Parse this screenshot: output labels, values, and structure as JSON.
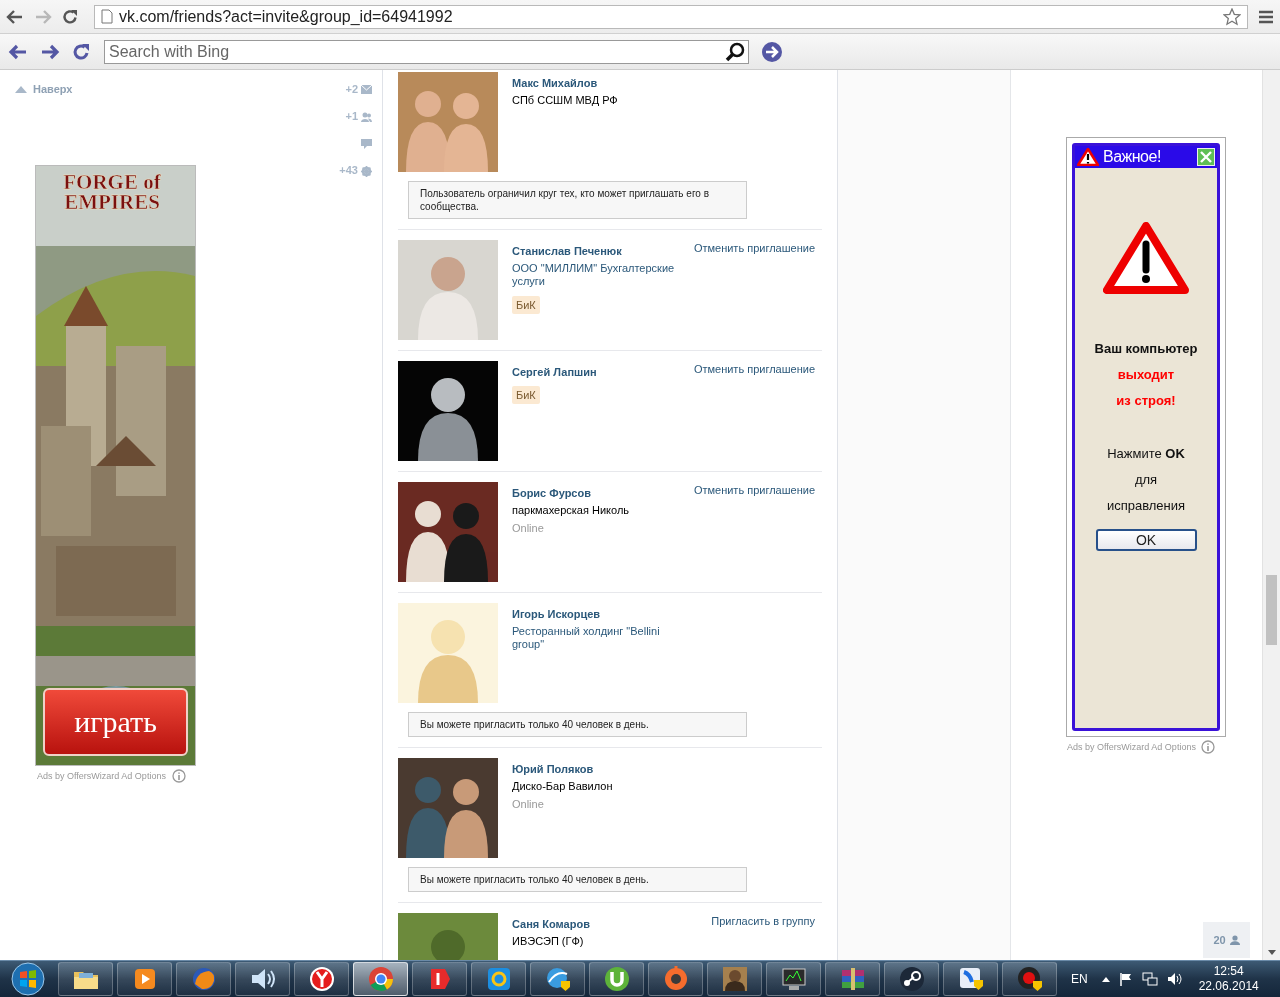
{
  "browser": {
    "url": "vk.com/friends?act=invite&group_id=64941992",
    "forward_disabled": true
  },
  "bing_bar": {
    "search": {
      "placeholder": "Search with Bing"
    }
  },
  "left_menu": {
    "top_link": "Наверх",
    "counters": [
      {
        "kind": "count",
        "count": "+2"
      },
      {
        "kind": "count",
        "count": "+1"
      },
      {
        "kind": "icon"
      },
      {
        "kind": "count",
        "count": "+43"
      }
    ]
  },
  "left_ad": {
    "logo": "FORGE of EMPIRES",
    "button": "играть",
    "footer": "Ads by OffersWizard Ad Options"
  },
  "people": [
    {
      "name": "Макс Михайлов",
      "subtitle": {
        "text": "СПб ССШМ МВД РФ",
        "kind": "text"
      },
      "notice": "Пользователь ограничил круг тех, кто может приглашать его в сообщества."
    },
    {
      "name": "Станислав Печенюк",
      "subtitle": {
        "text": "ООО \"МИЛЛИМ\" Бухгалтерские услуги",
        "kind": "link"
      },
      "tag": "БиК",
      "action": "Отменить приглашение"
    },
    {
      "name": "Сергей Лапшин",
      "tag": "БиК",
      "action": "Отменить приглашение"
    },
    {
      "name": "Борис Фурсов",
      "subtitle": {
        "text": "паркмахерская Николь",
        "kind": "text"
      },
      "status": "Online",
      "action": "Отменить приглашение"
    },
    {
      "name": "Игорь Искорцев",
      "subtitle": {
        "text": "Ресторанный холдинг \"Bellini group\"",
        "kind": "link"
      },
      "notice": "Вы можете пригласить только 40 человек в день."
    },
    {
      "name": "Юрий Поляков",
      "subtitle": {
        "text": "Диско-Бар Вавилон",
        "kind": "text"
      },
      "status": "Online",
      "notice": "Вы можете пригласить только 40 человек в день."
    },
    {
      "name": "Саня Комаров",
      "subtitle": {
        "text": "ИВЭСЭП (ГФ)",
        "kind": "text"
      },
      "action": "Пригласить в группу"
    }
  ],
  "right_ad": {
    "title": "Важное!",
    "lines": [
      {
        "text": "Ваш компьютер",
        "kind": "bold"
      },
      {
        "text": "выходит",
        "kind": "alert"
      },
      {
        "text": "из строя!",
        "kind": "alert"
      },
      {
        "text": "Нажмите **OK**",
        "kind": "plain"
      },
      {
        "text": "для",
        "kind": "plain"
      },
      {
        "text": "исправления",
        "kind": "plain"
      }
    ],
    "button": "OK",
    "footer": "Ads by OffersWizard Ad Options"
  },
  "friends_counter": {
    "count": "20"
  },
  "taskbar": {
    "apps": [
      {
        "selected": false
      },
      {
        "selected": false
      },
      {
        "selected": false
      },
      {
        "selected": false
      },
      {
        "selected": false
      },
      {
        "selected": true
      },
      {
        "selected": false
      },
      {
        "selected": false
      },
      {
        "selected": false
      },
      {
        "selected": false
      },
      {
        "selected": false
      },
      {
        "selected": false
      },
      {
        "selected": false
      },
      {
        "selected": false
      },
      {
        "selected": false
      },
      {
        "selected": false
      },
      {
        "selected": false
      }
    ],
    "language": "EN",
    "time": "12:54",
    "date": "22.06.2014"
  }
}
